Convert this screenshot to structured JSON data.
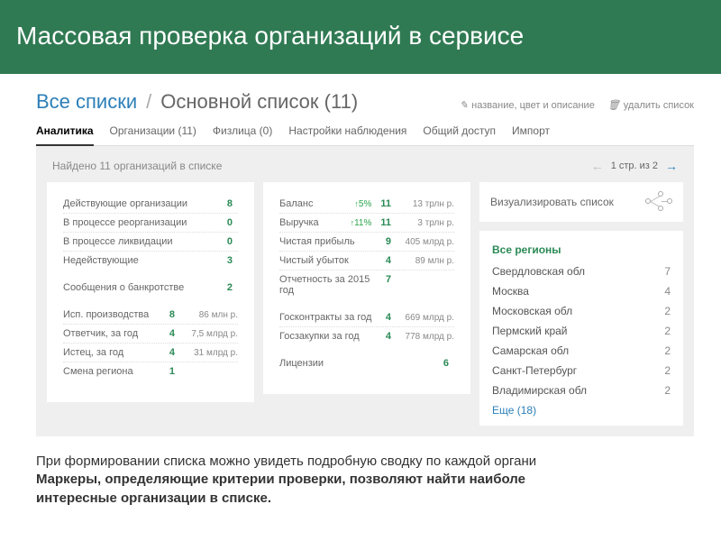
{
  "hero": {
    "title": "Массовая проверка организаций в сервисе"
  },
  "breadcrumb": {
    "root": "Все списки",
    "title": "Основной список (11)",
    "edit": "название, цвет и описание",
    "delete": "удалить список"
  },
  "tabs": [
    {
      "label": "Аналитика",
      "active": true
    },
    {
      "label": "Организации (11)"
    },
    {
      "label": "Физлица (0)"
    },
    {
      "label": "Настройки наблюдения"
    },
    {
      "label": "Общий доступ"
    },
    {
      "label": "Импорт"
    }
  ],
  "finder": {
    "text": "Найдено 11 организаций в списке",
    "page": "1 стр. из 2"
  },
  "left": {
    "status": [
      {
        "label": "Действующие организации",
        "count": "8"
      },
      {
        "label": "В процессе реорганизации",
        "count": "0"
      },
      {
        "label": "В процессе ликвидации",
        "count": "0"
      },
      {
        "label": "Недействующие",
        "count": "3"
      }
    ],
    "bank": {
      "label": "Сообщения о банкротстве",
      "count": "2"
    },
    "legal": [
      {
        "label": "Исп. производства",
        "count": "8",
        "value": "86 млн р."
      },
      {
        "label": "Ответчик, за год",
        "count": "4",
        "value": "7,5 млрд р."
      },
      {
        "label": "Истец, за год",
        "count": "4",
        "value": "31 млрд р."
      },
      {
        "label": "Смена региона",
        "count": "1",
        "value": ""
      }
    ]
  },
  "mid": {
    "finance": [
      {
        "label": "Баланс",
        "delta": "5%",
        "count": "11",
        "value": "13 трлн р."
      },
      {
        "label": "Выручка",
        "delta": "11%",
        "count": "11",
        "value": "3 трлн р."
      },
      {
        "label": "Чистая прибыль",
        "delta": "",
        "count": "9",
        "value": "405 млрд р."
      },
      {
        "label": "Чистый убыток",
        "delta": "",
        "count": "4",
        "value": "89 млн р."
      },
      {
        "label": "Отчетность за 2015 год",
        "delta": "",
        "count": "7",
        "value": ""
      }
    ],
    "gov": [
      {
        "label": "Госконтракты за год",
        "count": "4",
        "value": "669 млрд р."
      },
      {
        "label": "Госзакупки за год",
        "count": "4",
        "value": "778 млрд р."
      }
    ],
    "lic": {
      "label": "Лицензии",
      "count": "6"
    }
  },
  "right": {
    "vis": "Визуализировать список",
    "regions_title": "Все регионы",
    "regions": [
      {
        "name": "Свердловская обл",
        "n": "7"
      },
      {
        "name": "Москва",
        "n": "4"
      },
      {
        "name": "Московская обл",
        "n": "2"
      },
      {
        "name": "Пермский край",
        "n": "2"
      },
      {
        "name": "Самарская обл",
        "n": "2"
      },
      {
        "name": "Санкт-Петербург",
        "n": "2"
      },
      {
        "name": "Владимирская обл",
        "n": "2"
      }
    ],
    "more": "Еще (18)"
  },
  "footnote": {
    "line1": "При формировании списка можно увидеть подробную сводку по каждой органи",
    "line2": "Маркеры, определяющие критерии проверки, позволяют найти наиболе",
    "line3": "интересные организации в списке."
  }
}
